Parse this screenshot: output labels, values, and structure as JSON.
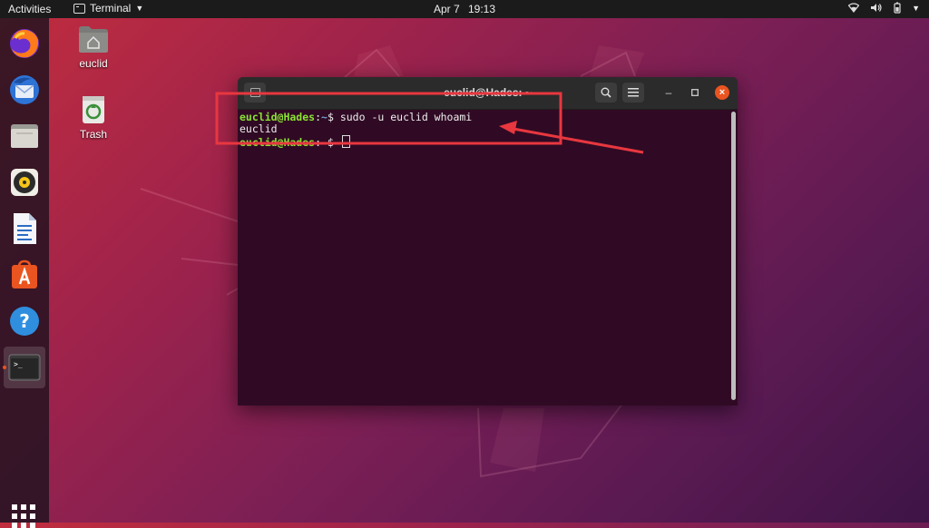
{
  "topbar": {
    "activities": "Activities",
    "app_name": "Terminal",
    "date": "Apr 7",
    "time": "19:13"
  },
  "dock": {
    "items": [
      {
        "name": "firefox",
        "icon": "firefox-icon"
      },
      {
        "name": "thunderbird",
        "icon": "thunderbird-icon"
      },
      {
        "name": "files",
        "icon": "files-icon"
      },
      {
        "name": "rhythmbox",
        "icon": "rhythmbox-icon"
      },
      {
        "name": "libreoffice-writer",
        "icon": "writer-icon"
      },
      {
        "name": "ubuntu-software",
        "icon": "software-icon"
      },
      {
        "name": "help",
        "icon": "help-icon",
        "glyph": "?"
      },
      {
        "name": "terminal",
        "icon": "terminal-icon",
        "glyph": ">_"
      }
    ],
    "show_apps_icon": "grid-icon"
  },
  "desktop": {
    "home_label": "euclid",
    "trash_label": "Trash"
  },
  "terminal": {
    "title": "euclid@Hades: ~",
    "lines": [
      {
        "user": "euclid@Hades",
        "sep": ":",
        "path": "~",
        "sign": "$",
        "command": " sudo -u euclid whoami"
      },
      {
        "output": "euclid"
      },
      {
        "user": "euclid@Hades",
        "sep": ":",
        "path": "~",
        "sign": "$",
        "command": " "
      }
    ]
  },
  "colors": {
    "accent": "#e95420",
    "annotation": "#e8373f",
    "terminal_bg": "#300a24",
    "prompt_user": "#8ae234",
    "prompt_path": "#729fcf"
  }
}
